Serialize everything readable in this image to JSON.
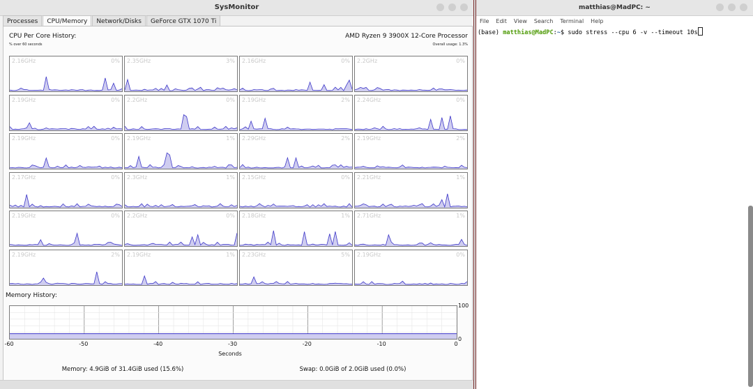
{
  "sysmon": {
    "title": "SysMonitor",
    "tabs": [
      "Processes",
      "CPU/Memory",
      "Network/Disks",
      "GeForce GTX 1070 Ti"
    ],
    "active_tab": 1,
    "cpu_history_label": "CPU Per Core History:",
    "cpu_history_sub": "% over 60 seconds",
    "cpu_name": "AMD Ryzen 9 3900X 12-Core Processor",
    "overall_usage": "Overall usage: 1.3%",
    "cores": [
      {
        "freq": "2.16GHz",
        "pct": "0%"
      },
      {
        "freq": "2.35GHz",
        "pct": "3%"
      },
      {
        "freq": "2.16GHz",
        "pct": "0%"
      },
      {
        "freq": "2.2GHz",
        "pct": "0%"
      },
      {
        "freq": "2.19GHz",
        "pct": "0%"
      },
      {
        "freq": "2.2GHz",
        "pct": "0%"
      },
      {
        "freq": "2.19GHz",
        "pct": "2%"
      },
      {
        "freq": "2.24GHz",
        "pct": "0%"
      },
      {
        "freq": "2.19GHz",
        "pct": "0%"
      },
      {
        "freq": "2.19GHz",
        "pct": "1%"
      },
      {
        "freq": "2.29GHz",
        "pct": "2%"
      },
      {
        "freq": "2.19GHz",
        "pct": "2%"
      },
      {
        "freq": "2.17GHz",
        "pct": "0%"
      },
      {
        "freq": "2.3GHz",
        "pct": "1%"
      },
      {
        "freq": "2.15GHz",
        "pct": "0%"
      },
      {
        "freq": "2.21GHz",
        "pct": "1%"
      },
      {
        "freq": "2.19GHz",
        "pct": "0%"
      },
      {
        "freq": "2.2GHz",
        "pct": "0%"
      },
      {
        "freq": "2.18GHz",
        "pct": "1%"
      },
      {
        "freq": "2.71GHz",
        "pct": "1%"
      },
      {
        "freq": "2.19GHz",
        "pct": "2%"
      },
      {
        "freq": "2.19GHz",
        "pct": "1%"
      },
      {
        "freq": "2.23GHz",
        "pct": "5%"
      },
      {
        "freq": "2.19GHz",
        "pct": "0%"
      }
    ],
    "memory_history_label": "Memory History:",
    "mem_y_max": "100",
    "mem_y_min": "0",
    "mem_x_ticks": [
      "-60",
      "-50",
      "-40",
      "-30",
      "-20",
      "-10",
      "0"
    ],
    "mem_x_label": "Seconds",
    "memory_used": "Memory: 4.9GiB of 31.4GiB used (15.6%)",
    "swap_used": "Swap: 0.0GiB of 2.0GiB used (0.0%)",
    "colors": {
      "line": "#3c36c8",
      "fill": "#cfcdf0"
    }
  },
  "terminal": {
    "title": "matthias@MadPC: ~",
    "menu": [
      "File",
      "Edit",
      "View",
      "Search",
      "Terminal",
      "Help"
    ],
    "prompt_env": "(base) ",
    "prompt_user": "matthias@MadPC",
    "prompt_sep": ":",
    "prompt_path": "~",
    "prompt_end": "$ ",
    "command": "sudo stress --cpu 6 -v --timeout 10s"
  }
}
